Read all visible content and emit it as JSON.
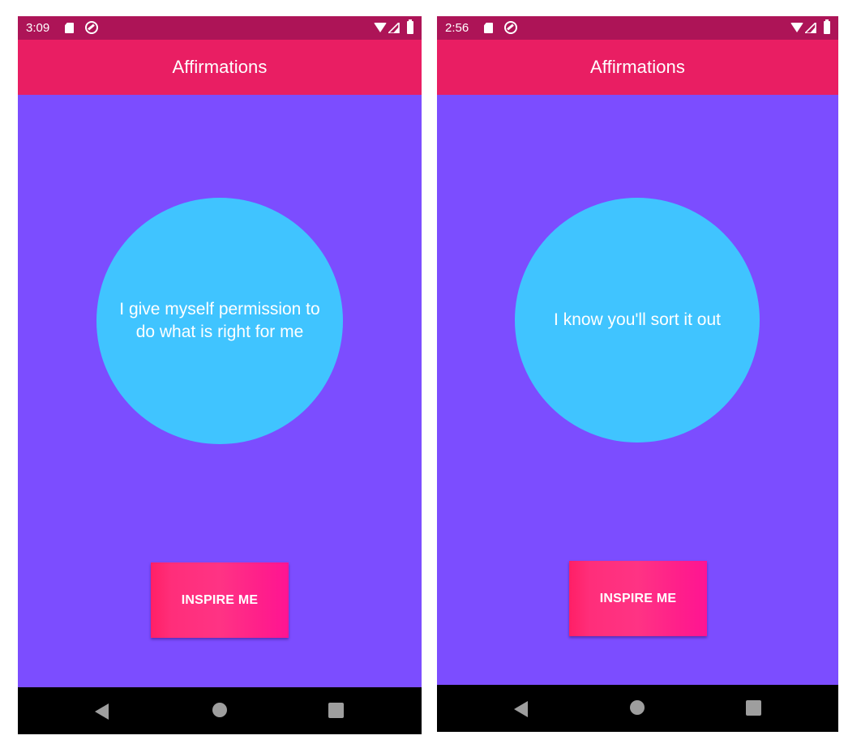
{
  "screens": [
    {
      "status_bar": {
        "time": "3:09",
        "icons": [
          "sd-card-icon",
          "do-not-disturb-icon",
          "wifi-icon",
          "cell-signal-icon",
          "battery-icon"
        ]
      },
      "app_bar": {
        "title": "Affirmations"
      },
      "affirmation": {
        "text": "I give myself permission to do what is right for me"
      },
      "button": {
        "label": "INSPIRE ME"
      },
      "nav_bar": {
        "icons": [
          "back-icon",
          "home-icon",
          "recents-icon"
        ]
      }
    },
    {
      "status_bar": {
        "time": "2:56",
        "icons": [
          "sd-card-icon",
          "do-not-disturb-icon",
          "wifi-icon",
          "cell-signal-icon",
          "battery-icon"
        ]
      },
      "app_bar": {
        "title": "Affirmations"
      },
      "affirmation": {
        "text": "I know you'll sort it out"
      },
      "button": {
        "label": "INSPIRE ME"
      },
      "nav_bar": {
        "icons": [
          "back-icon",
          "home-icon",
          "recents-icon"
        ]
      }
    }
  ],
  "colors": {
    "status_bar": "#ad1457",
    "app_bar": "#e91e63",
    "background": "#7c4dff",
    "circle": "#40c4ff",
    "button_gradient_start": "#ff1f66",
    "button_gradient_end": "#ff1493",
    "nav_bar": "#000000",
    "nav_icons": "#9e9e9e"
  }
}
